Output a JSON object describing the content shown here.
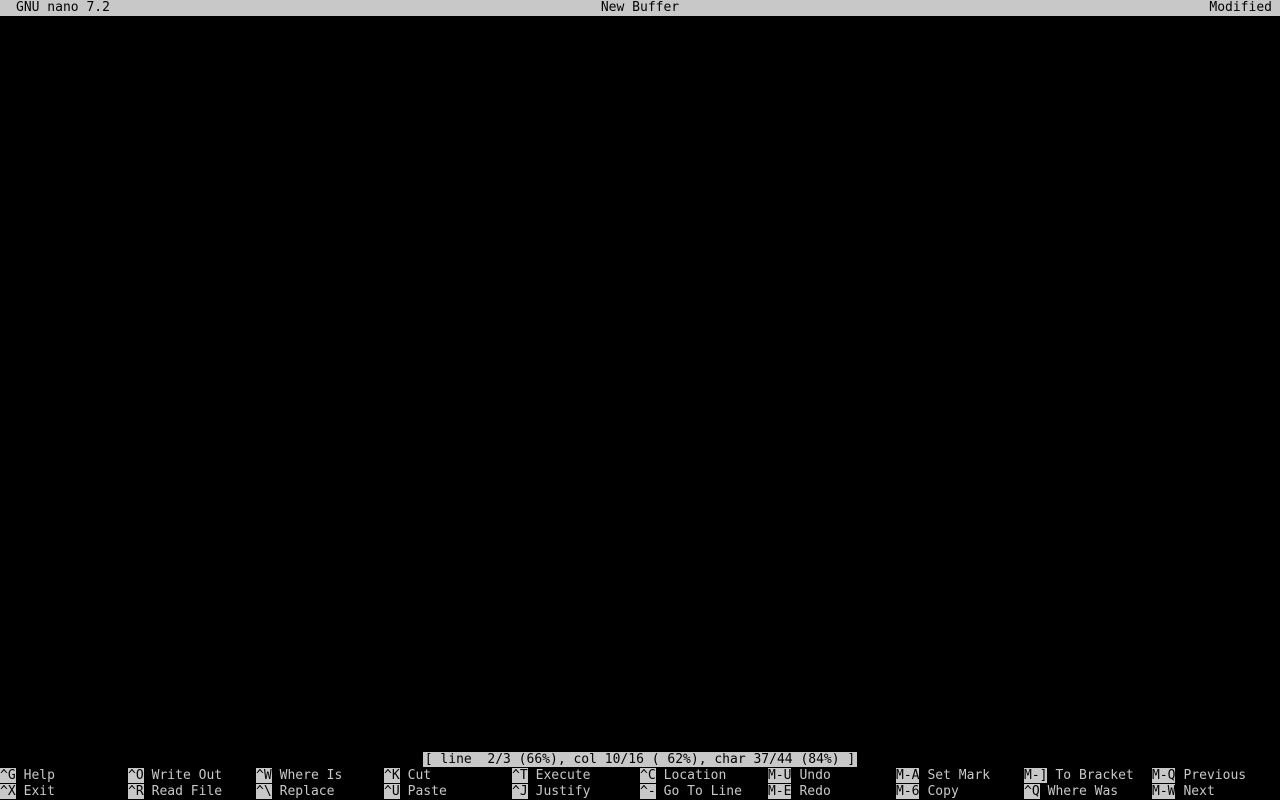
{
  "titlebar": {
    "app": "GNU nano 7.2",
    "file": "New Buffer",
    "state": "Modified"
  },
  "buffer": {
    "lines": [
      "",
      ""
    ]
  },
  "status": {
    "text": "[ line  2/3 (66%), col 10/16 ( 62%), char 37/44 (84%) ]"
  },
  "shortcuts": {
    "row1": [
      {
        "key": "^G",
        "label": "Help"
      },
      {
        "key": "^O",
        "label": "Write Out"
      },
      {
        "key": "^W",
        "label": "Where Is"
      },
      {
        "key": "^K",
        "label": "Cut"
      },
      {
        "key": "^T",
        "label": "Execute"
      },
      {
        "key": "^C",
        "label": "Location"
      },
      {
        "key": "M-U",
        "label": "Undo"
      },
      {
        "key": "M-A",
        "label": "Set Mark"
      },
      {
        "key": "M-]",
        "label": "To Bracket"
      },
      {
        "key": "M-Q",
        "label": "Previous"
      }
    ],
    "row2": [
      {
        "key": "^X",
        "label": "Exit"
      },
      {
        "key": "^R",
        "label": "Read File"
      },
      {
        "key": "^\\",
        "label": "Replace"
      },
      {
        "key": "^U",
        "label": "Paste"
      },
      {
        "key": "^J",
        "label": "Justify"
      },
      {
        "key": "^-",
        "label": "Go To Line"
      },
      {
        "key": "M-E",
        "label": "Redo"
      },
      {
        "key": "M-6",
        "label": "Copy"
      },
      {
        "key": "^Q",
        "label": "Where Was"
      },
      {
        "key": "M-W",
        "label": "Next"
      }
    ]
  },
  "colors": {
    "background": "#000000",
    "foreground": "#c8c8c8",
    "inverse_background": "#c8c8c8",
    "inverse_foreground": "#000000"
  }
}
